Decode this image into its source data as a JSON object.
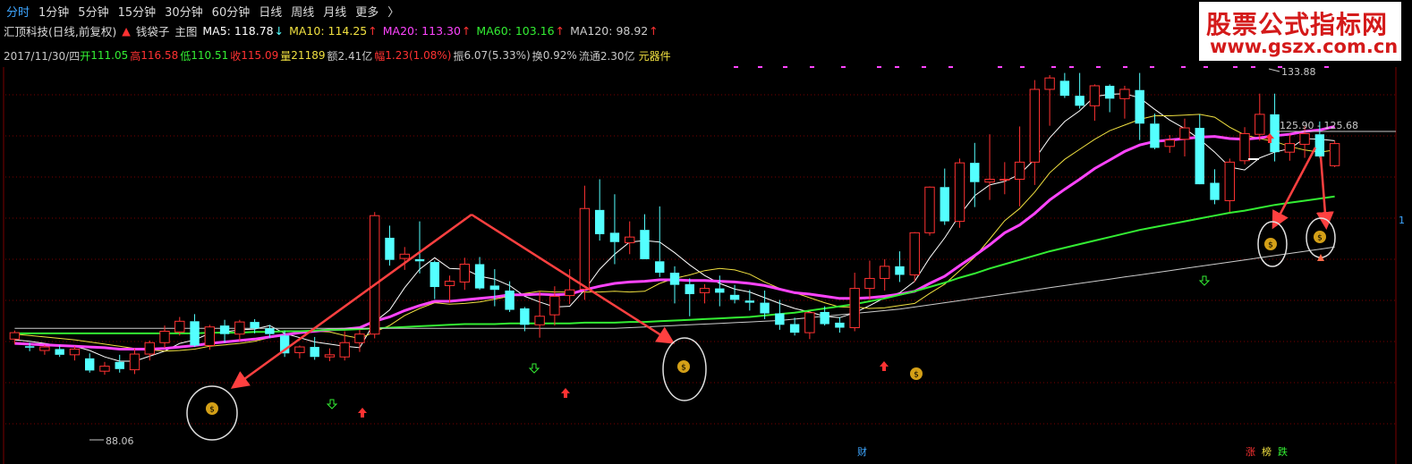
{
  "toolbar": {
    "items": [
      "分时",
      "1分钟",
      "5分钟",
      "15分钟",
      "30分钟",
      "60分钟",
      "日线",
      "周线",
      "月线",
      "更多"
    ],
    "active": "分时",
    "more_arrow": "〉"
  },
  "ma_bar": {
    "stock": "汇顶科技(日线,前复权)",
    "indicator": "钱袋子",
    "main_chart": "主图",
    "ma5": "MA5: 118.78",
    "ma10": "MA10: 114.25",
    "ma20": "MA20: 113.30",
    "ma60": "MA60: 103.16",
    "ma120": "MA120: 98.92",
    "colors": {
      "ma5": "#ffffff",
      "ma10": "#f0e040",
      "ma20": "#ff44ff",
      "ma60": "#33ee33",
      "ma120": "#cccccc"
    }
  },
  "info_bar": {
    "date": "2017/11/30/四",
    "open_label": "开",
    "open": "111.05",
    "high_label": "高",
    "high": "116.58",
    "low_label": "低",
    "low": "110.51",
    "close_label": "收",
    "close": "115.09",
    "vol_label": "量",
    "vol": "21189",
    "amt_label": "额",
    "amt": "2.41亿",
    "chg_label": "幅",
    "chg": "1.23(1.08%)",
    "amp_label": "振",
    "amp": "6.07(5.33%)",
    "turn_label": "换",
    "turn": "0.92%",
    "float_label": "流通",
    "float": "2.30亿",
    "concept": "元器件"
  },
  "watermark": {
    "line1": "股票公式指标网",
    "line2": "www.gszx.com.cn"
  },
  "annotations": {
    "high": "133.88",
    "low": "88.06",
    "gap": "125.90 - 125.68",
    "right_edge": "1"
  },
  "bottom_markers": {
    "cai": "财",
    "zhang": "涨",
    "bang": "榜",
    "die": "跌"
  },
  "colors": {
    "up": "#ff3232",
    "down": "#54ffff",
    "ma20": "#ff44ff",
    "ma60": "#33ee33",
    "ma120": "#cccccc",
    "ma5": "#ffffff",
    "ma10": "#f0e040",
    "grid": "#7a0000",
    "bag": "#d4a017"
  },
  "chart_data": {
    "type": "candlestick",
    "y_range": [
      85,
      137
    ],
    "candles": [
      [
        99.5,
        100.7,
        98.8,
        100.4
      ],
      [
        98.5,
        99.0,
        97.8,
        98.3
      ],
      [
        97.9,
        98.7,
        97.3,
        98.4
      ],
      [
        98.1,
        98.6,
        97.0,
        97.3
      ],
      [
        97.3,
        98.5,
        96.5,
        98.1
      ],
      [
        96.8,
        97.5,
        94.8,
        95.1
      ],
      [
        95.0,
        96.3,
        94.5,
        95.7
      ],
      [
        96.3,
        97.3,
        94.8,
        95.3
      ],
      [
        95.2,
        98.2,
        94.6,
        97.4
      ],
      [
        97.4,
        99.3,
        96.5,
        99.0
      ],
      [
        99.0,
        101.4,
        98.2,
        100.6
      ],
      [
        100.5,
        102.6,
        100.0,
        102.0
      ],
      [
        102.0,
        103.0,
        98.4,
        98.6
      ],
      [
        98.6,
        101.5,
        98.0,
        101.2
      ],
      [
        101.4,
        102.2,
        99.0,
        100.2
      ],
      [
        100.2,
        102.2,
        99.2,
        101.9
      ],
      [
        101.9,
        102.3,
        100.3,
        101.0
      ],
      [
        101.0,
        101.5,
        99.7,
        100.2
      ],
      [
        100.0,
        100.7,
        97.0,
        97.5
      ],
      [
        97.6,
        98.6,
        96.8,
        98.4
      ],
      [
        98.4,
        99.8,
        96.6,
        97.0
      ],
      [
        97.0,
        98.2,
        96.4,
        97.3
      ],
      [
        97.0,
        100.6,
        96.5,
        99.0
      ],
      [
        99.0,
        100.8,
        97.7,
        100.2
      ],
      [
        100.2,
        117.3,
        99.6,
        116.8
      ],
      [
        113.7,
        115.4,
        109.8,
        110.6
      ],
      [
        110.8,
        112.4,
        109.2,
        111.4
      ],
      [
        110.7,
        116.0,
        108.7,
        110.4
      ],
      [
        110.3,
        110.5,
        105.1,
        106.8
      ],
      [
        107.0,
        108.4,
        104.6,
        107.6
      ],
      [
        107.5,
        110.9,
        106.4,
        110.0
      ],
      [
        110.0,
        111.0,
        106.4,
        106.6
      ],
      [
        107.0,
        109.3,
        104.1,
        106.4
      ],
      [
        106.3,
        107.6,
        103.3,
        103.6
      ],
      [
        103.8,
        104.0,
        100.6,
        101.5
      ],
      [
        101.5,
        106.2,
        99.7,
        102.7
      ],
      [
        102.9,
        106.9,
        101.4,
        105.5
      ],
      [
        105.6,
        109.3,
        104.4,
        106.4
      ],
      [
        106.5,
        121.0,
        105.0,
        117.8
      ],
      [
        117.6,
        121.9,
        113.3,
        114.2
      ],
      [
        114.4,
        119.8,
        110.0,
        113.1
      ],
      [
        113.0,
        116.0,
        111.4,
        113.8
      ],
      [
        114.8,
        117.0,
        111.1,
        110.7
      ],
      [
        110.4,
        118.1,
        108.2,
        108.8
      ],
      [
        108.8,
        109.7,
        104.5,
        107.1
      ],
      [
        107.2,
        108.0,
        102.7,
        105.8
      ],
      [
        106.0,
        107.2,
        104.5,
        106.6
      ],
      [
        106.6,
        108.4,
        104.1,
        106.0
      ],
      [
        105.7,
        107.1,
        104.5,
        105.0
      ],
      [
        104.9,
        106.4,
        103.5,
        104.6
      ],
      [
        104.6,
        106.3,
        102.3,
        103.1
      ],
      [
        103.1,
        105.0,
        100.8,
        101.5
      ],
      [
        101.6,
        102.5,
        100.0,
        100.4
      ],
      [
        100.4,
        103.4,
        99.5,
        103.2
      ],
      [
        103.3,
        104.1,
        101.4,
        101.6
      ],
      [
        101.8,
        102.6,
        100.4,
        101.1
      ],
      [
        101.1,
        108.8,
        100.6,
        106.6
      ],
      [
        106.6,
        110.5,
        105.0,
        108.0
      ],
      [
        108.0,
        110.7,
        106.3,
        109.7
      ],
      [
        109.7,
        111.8,
        107.5,
        108.5
      ],
      [
        108.5,
        114.5,
        107.5,
        114.4
      ],
      [
        114.4,
        120.9,
        114.0,
        120.8
      ],
      [
        120.8,
        123.4,
        115.5,
        116.0
      ],
      [
        116.0,
        124.8,
        115.1,
        124.2
      ],
      [
        124.2,
        127.0,
        118.0,
        121.5
      ],
      [
        121.5,
        128.2,
        119.0,
        121.9
      ],
      [
        121.9,
        124.3,
        119.8,
        121.9
      ],
      [
        121.9,
        129.3,
        118.1,
        124.3
      ],
      [
        124.3,
        135.8,
        121.1,
        134.5
      ],
      [
        134.5,
        136.5,
        129.4,
        136.1
      ],
      [
        135.7,
        136.8,
        133.3,
        133.6
      ],
      [
        133.6,
        136.8,
        131.8,
        132.2
      ],
      [
        132.2,
        135.2,
        130.1,
        135.0
      ],
      [
        135.0,
        135.2,
        131.3,
        133.2
      ],
      [
        133.2,
        135.0,
        130.4,
        134.5
      ],
      [
        134.4,
        136.8,
        127.4,
        129.7
      ],
      [
        129.7,
        131.1,
        126.1,
        126.3
      ],
      [
        126.5,
        128.1,
        125.6,
        127.4
      ],
      [
        127.5,
        130.4,
        125.1,
        129.1
      ],
      [
        129.1,
        131.0,
        121.5,
        121.2
      ],
      [
        121.4,
        123.3,
        118.4,
        119.0
      ],
      [
        118.9,
        124.8,
        117.3,
        124.3
      ],
      [
        124.5,
        129.2,
        124.0,
        128.3
      ],
      [
        128.2,
        133.9,
        127.3,
        131.0
      ],
      [
        131.0,
        133.9,
        124.4,
        125.7
      ],
      [
        125.7,
        128.2,
        124.5,
        126.9
      ],
      [
        126.8,
        129.3,
        124.9,
        128.3
      ],
      [
        128.2,
        130.0,
        124.9,
        125.1
      ],
      [
        123.8,
        127.3,
        123.6,
        126.9
      ]
    ],
    "series": [
      {
        "name": "MA5",
        "values": [
          99.4,
          99.2,
          98.9,
          98.6,
          98.5,
          97.9,
          97.0,
          96.4,
          96.4,
          97.1,
          97.8,
          98.9,
          99.4,
          100.3,
          100.5,
          100.8,
          100.9,
          101.4,
          100.3,
          99.7,
          99.1,
          98.8,
          98.5,
          98.3,
          101.9,
          103.6,
          106.7,
          109.3,
          110.9,
          109.4,
          109.3,
          108.3,
          107.9,
          107.0,
          105.5,
          104.7,
          104.0,
          104.1,
          106.4,
          109.3,
          111.4,
          113.1,
          113.3,
          113.1,
          111.6,
          109.9,
          108.4,
          107.3,
          106.5,
          106.1,
          105.3,
          104.5,
          103.8,
          103.3,
          102.7,
          102.5,
          103.2,
          104.2,
          105.3,
          106.0,
          107.6,
          110.9,
          113.7,
          116.9,
          119.6,
          121.1,
          121.6,
          122.6,
          124.7,
          127.7,
          130.0,
          131.5,
          133.5,
          133.8,
          133.9,
          133.3,
          131.7,
          130.2,
          129.0,
          127.5,
          125.7,
          123.6,
          123.2,
          124.9,
          125.7,
          126.2,
          127.6,
          127.5,
          127.3
        ]
      },
      {
        "name": "MA10",
        "values": [
          100.2,
          100.0,
          99.8,
          99.6,
          99.4,
          99.1,
          98.8,
          98.5,
          98.2,
          98.0,
          97.8,
          97.9,
          98.1,
          98.5,
          98.7,
          98.9,
          99.2,
          99.7,
          100.0,
          100.4,
          100.6,
          100.5,
          100.0,
          99.6,
          100.5,
          101.4,
          102.8,
          103.8,
          104.6,
          104.4,
          104.5,
          104.7,
          105.1,
          105.5,
          105.9,
          106.2,
          106.1,
          106.1,
          106.1,
          106.1,
          106.2,
          106.1,
          106.2,
          107.3,
          108.0,
          108.5,
          109.1,
          109.4,
          109.2,
          108.6,
          107.5,
          106.6,
          106.0,
          105.3,
          104.6,
          104.0,
          104.0,
          103.8,
          103.9,
          104.2,
          104.5,
          105.9,
          107.2,
          109.1,
          111.0,
          113.5,
          116.1,
          117.8,
          120.1,
          122.8,
          124.7,
          126.1,
          127.5,
          128.7,
          129.5,
          130.3,
          130.8,
          130.8,
          130.9,
          131.0,
          130.6,
          129.2,
          128.1,
          127.6,
          127.2,
          126.5,
          126.0,
          125.7,
          126.0
        ]
      },
      {
        "name": "MA20",
        "values": [
          98.9,
          98.8,
          98.7,
          98.6,
          98.5,
          98.4,
          98.3,
          98.1,
          98.1,
          98.1,
          98.2,
          98.4,
          98.6,
          98.9,
          99.1,
          99.3,
          99.5,
          99.8,
          100.1,
          100.4,
          100.6,
          100.8,
          100.9,
          101.1,
          102.0,
          102.6,
          103.5,
          104.2,
          104.8,
          104.8,
          105.0,
          105.2,
          105.4,
          105.7,
          105.7,
          105.8,
          105.7,
          105.8,
          106.4,
          106.9,
          107.3,
          107.5,
          107.6,
          107.8,
          107.8,
          107.7,
          107.7,
          107.6,
          107.5,
          107.3,
          107.0,
          106.5,
          106.0,
          105.8,
          105.5,
          105.2,
          105.2,
          105.3,
          105.5,
          105.8,
          106.2,
          107.3,
          108.3,
          109.8,
          111.2,
          112.7,
          114.4,
          115.5,
          117.1,
          119.0,
          120.5,
          121.9,
          123.4,
          124.6,
          125.8,
          126.7,
          127.2,
          127.4,
          127.6,
          127.8,
          127.9,
          127.6,
          127.5,
          127.7,
          128.0,
          128.2,
          128.6,
          128.8,
          129.3
        ]
      },
      {
        "name": "MA60",
        "values": [
          100.3,
          100.3,
          100.3,
          100.3,
          100.3,
          100.3,
          100.3,
          100.3,
          100.3,
          100.3,
          100.3,
          100.3,
          100.3,
          100.4,
          100.4,
          100.4,
          100.5,
          100.5,
          100.6,
          100.6,
          100.7,
          100.8,
          100.8,
          100.9,
          101.0,
          101.1,
          101.2,
          101.3,
          101.4,
          101.5,
          101.6,
          101.6,
          101.6,
          101.7,
          101.7,
          101.7,
          101.7,
          101.7,
          101.8,
          101.8,
          101.8,
          101.9,
          101.9,
          102.0,
          102.1,
          102.2,
          102.3,
          102.4,
          102.5,
          102.6,
          102.8,
          103.0,
          103.2,
          103.5,
          103.8,
          104.1,
          104.4,
          104.8,
          105.2,
          105.7,
          106.2,
          106.8,
          107.4,
          108.1,
          108.7,
          109.4,
          110.0,
          110.6,
          111.2,
          111.8,
          112.3,
          112.8,
          113.3,
          113.8,
          114.3,
          114.8,
          115.2,
          115.6,
          116.0,
          116.4,
          116.8,
          117.2,
          117.5,
          117.9,
          118.3,
          118.6,
          118.9,
          119.2,
          119.5
        ]
      },
      {
        "name": "MA120",
        "values": [
          101.0,
          101.0,
          101.0,
          101.0,
          101.0,
          101.0,
          101.0,
          101.0,
          101.0,
          101.0,
          101.0,
          101.0,
          101.0,
          101.0,
          101.0,
          101.0,
          101.0,
          101.0,
          101.0,
          101.0,
          101.0,
          101.0,
          101.0,
          101.0,
          101.0,
          101.0,
          101.0,
          101.0,
          101.0,
          101.0,
          101.0,
          101.0,
          101.0,
          101.0,
          101.0,
          101.0,
          101.0,
          101.0,
          101.0,
          101.0,
          101.0,
          101.1,
          101.2,
          101.3,
          101.4,
          101.5,
          101.6,
          101.7,
          101.8,
          101.9,
          102.0,
          102.1,
          102.3,
          102.5,
          102.7,
          102.9,
          103.1,
          103.3,
          103.5,
          103.7,
          104.0,
          104.3,
          104.6,
          104.9,
          105.2,
          105.5,
          105.8,
          106.1,
          106.4,
          106.7,
          107.0,
          107.3,
          107.6,
          107.9,
          108.2,
          108.5,
          108.8,
          109.1,
          109.4,
          109.7,
          110.0,
          110.3,
          110.6,
          110.9,
          111.2,
          111.5,
          111.8,
          112.1,
          112.4
        ]
      }
    ]
  }
}
